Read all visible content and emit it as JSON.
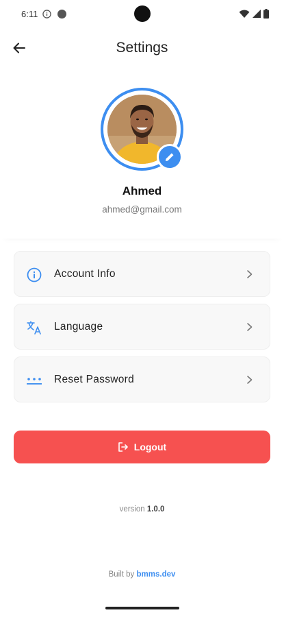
{
  "status_bar": {
    "time": "6:11",
    "icons": [
      "info-icon",
      "dot-icon",
      "wifi-icon",
      "signal-icon",
      "battery-icon"
    ]
  },
  "header": {
    "title": "Settings",
    "back_icon": "arrow-left-icon"
  },
  "profile": {
    "name": "Ahmed",
    "email": "ahmed@gmail.com",
    "edit_icon": "pencil-icon"
  },
  "menu": {
    "items": [
      {
        "label": "Account Info",
        "icon": "info-circle-icon"
      },
      {
        "label": "Language",
        "icon": "translate-icon"
      },
      {
        "label": "Reset Password",
        "icon": "password-dots-icon"
      }
    ]
  },
  "logout": {
    "label": "Logout",
    "icon": "logout-icon"
  },
  "footer": {
    "version_prefix": "version",
    "version_number": "1.0.0",
    "built_by_prefix": "Built by",
    "built_by_link": "bmms.dev"
  },
  "colors": {
    "accent": "#3d8ef0",
    "danger": "#f65150",
    "card_bg": "#f8f8f8"
  }
}
